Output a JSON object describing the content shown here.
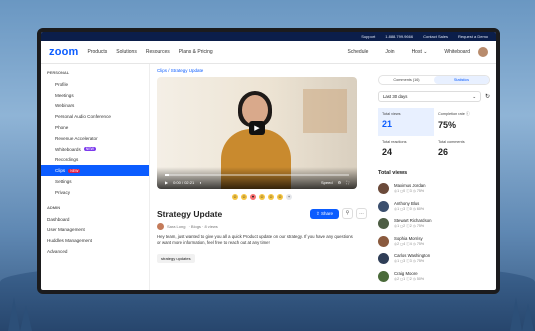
{
  "utility_bar": {
    "items": [
      "Support",
      "1.888.799.9666",
      "Contact Sales",
      "Request a Demo"
    ]
  },
  "nav": {
    "logo": "zoom",
    "items": [
      "Products",
      "Solutions",
      "Resources",
      "Plans & Pricing"
    ],
    "right": {
      "schedule": "Schedule",
      "join": "Join",
      "host": "Host ⌄",
      "whiteboard": "Whiteboard"
    }
  },
  "sidebar": {
    "personal_header": "PERSONAL",
    "personal": [
      {
        "label": "Profile"
      },
      {
        "label": "Meetings"
      },
      {
        "label": "Webinars"
      },
      {
        "label": "Personal Audio Conference"
      },
      {
        "label": "Phone"
      },
      {
        "label": "Revenue Accelerator"
      },
      {
        "label": "Whiteboards",
        "badge": "NEW"
      },
      {
        "label": "Recordings"
      },
      {
        "label": "Clips",
        "badge": "NEW",
        "active": true
      },
      {
        "label": "Settings"
      },
      {
        "label": "Privacy"
      }
    ],
    "admin_header": "ADMIN",
    "admin": [
      {
        "label": "Dashboard"
      },
      {
        "label": "User Management"
      },
      {
        "label": "Huddles Management"
      },
      {
        "label": "Advanced"
      }
    ]
  },
  "main": {
    "breadcrumb": "Clips / Strategy Update",
    "video": {
      "time": "0:00 / 02:21",
      "speed": "Speed",
      "progress": 0.02
    },
    "title": "Strategy Update",
    "share_label": "Share",
    "author": "Sara Long",
    "meta": "· Blogs · 8 views",
    "description": "Hey team, just wanted to give you all a quick Product update on our strategy. If you have any questions or want more information, feel free to reach out at any time!",
    "tag": "strategy updates"
  },
  "stats": {
    "tabs": [
      "Comments (16)",
      "Statistics"
    ],
    "active_tab": 1,
    "range": "Last 30 days",
    "cards": [
      {
        "label": "Total views",
        "value": "21"
      },
      {
        "label": "Completion rate ⓘ",
        "value": "75%"
      },
      {
        "label": "Total reactions",
        "value": "24"
      },
      {
        "label": "Total comments",
        "value": "26"
      }
    ],
    "total_views_heading": "Total views",
    "viewers": [
      {
        "name": "Maximus Jordan",
        "stats": "◎1  ◻0  ⓘ3  ◷ 75%",
        "color": "#6b4a3a"
      },
      {
        "name": "Anthony Blus",
        "stats": "◎1  ◻3  ⓘ0  ◷ 60%",
        "color": "#3b4f6e"
      },
      {
        "name": "Stewart Richardson",
        "stats": "◎1  ◻2  ⓘ2  ◷ 75%",
        "color": "#4d5d44"
      },
      {
        "name": "Sophia Morrisy",
        "stats": "◎2  ◻4  ⓘ4  ◷ 75%",
        "color": "#8a5a3e"
      },
      {
        "name": "Carlos Washington",
        "stats": "◎1  ◻3  ⓘ3  ◷ 75%",
        "color": "#2f3e57"
      },
      {
        "name": "Craig Moore",
        "stats": "◎2  ◻1  ⓘ2  ◷ 50%",
        "color": "#4a6a3a"
      }
    ]
  }
}
